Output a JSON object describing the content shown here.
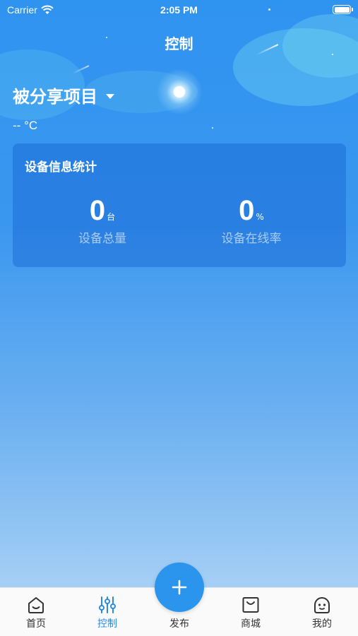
{
  "status_bar": {
    "carrier": "Carrier",
    "time": "2:05 PM"
  },
  "header": {
    "title": "控制"
  },
  "project": {
    "name": "被分享项目",
    "temperature": "--  °C"
  },
  "stats_card": {
    "title": "设备信息统计",
    "device_total": {
      "value": "0",
      "unit": "台",
      "label": "设备总量"
    },
    "online_rate": {
      "value": "0",
      "unit": "%",
      "label": "设备在线率"
    }
  },
  "tabbar": {
    "items": [
      {
        "label": "首页",
        "icon": "home-icon"
      },
      {
        "label": "控制",
        "icon": "sliders-icon",
        "active": true
      },
      {
        "label": "发布",
        "icon": "plus-icon"
      },
      {
        "label": "商城",
        "icon": "shopping-bag-icon"
      },
      {
        "label": "我的",
        "icon": "face-icon"
      }
    ],
    "active_color": "#2b8ae6"
  }
}
